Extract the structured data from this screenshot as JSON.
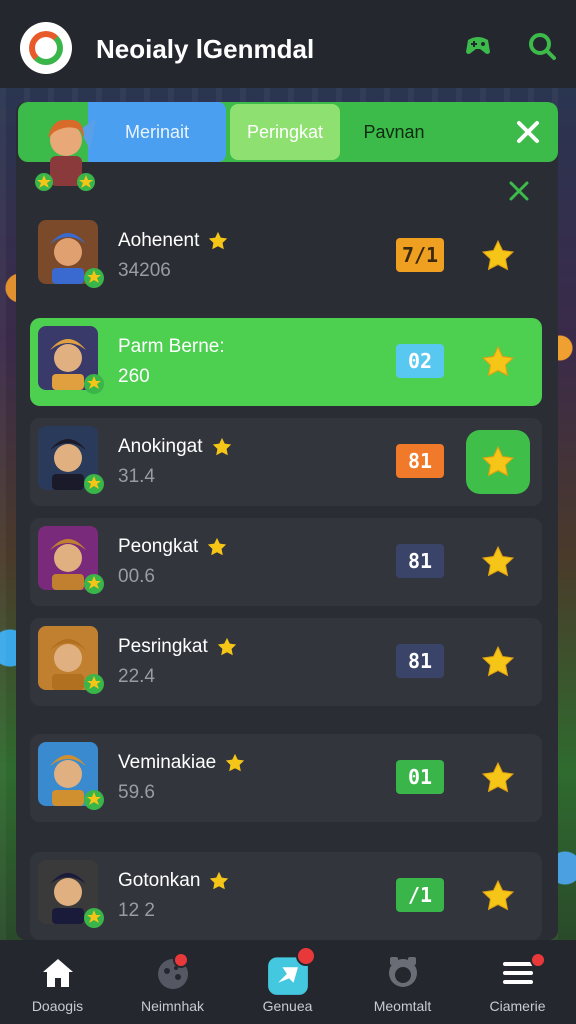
{
  "header": {
    "title": "Neoialy lGenmdal",
    "icons": [
      "app-logo",
      "controller-icon",
      "search-icon"
    ]
  },
  "tabs": [
    {
      "label": "Merinait"
    },
    {
      "label": "Peringkat"
    },
    {
      "label": "Pavnan"
    }
  ],
  "colors": {
    "accent_green": "#3cbb4a",
    "active_row": "#4dcf50",
    "tab_blue": "#4a9ff0",
    "star": "#f5c518"
  },
  "rows": [
    {
      "name": "Aohenent",
      "score": "34206",
      "rank": "7/1",
      "rank_color": "#f0a020",
      "rank_text_color": "#3a2a10",
      "fav_active": false
    },
    {
      "name": "Parm Berne:",
      "score": "260",
      "rank": "02",
      "rank_color": "#58c8f0",
      "rank_text_color": "#ffffff",
      "fav_active": false
    },
    {
      "name": "Anokingat",
      "score": "31.4",
      "rank": "81",
      "rank_color": "#f07a2a",
      "rank_text_color": "#ffffff",
      "fav_active": true
    },
    {
      "name": "Peongkat",
      "score": "00.6",
      "rank": "81",
      "rank_color": "#3a4468",
      "rank_text_color": "#ffffff",
      "fav_active": false
    },
    {
      "name": "Pesringkat",
      "score": "22.4",
      "rank": "81",
      "rank_color": "#3a4468",
      "rank_text_color": "#ffffff",
      "fav_active": false
    },
    {
      "name": "Veminakiae",
      "score": "59.6",
      "rank": "01",
      "rank_color": "#3ab54a",
      "rank_text_color": "#ffffff",
      "fav_active": false
    },
    {
      "name": "Gotonkan",
      "score": "12 2",
      "rank": "/1",
      "rank_color": "#3ab54a",
      "rank_text_color": "#ffffff",
      "fav_active": false
    }
  ],
  "nav": [
    {
      "label": "Doaogis",
      "icon": "home-icon"
    },
    {
      "label": "Neimnhak",
      "icon": "gamepad-icon"
    },
    {
      "label": "Genuea",
      "icon": "play-icon"
    },
    {
      "label": "Meomtalt",
      "icon": "settings-icon"
    },
    {
      "label": "Ciamerie",
      "icon": "menu-icon"
    }
  ]
}
